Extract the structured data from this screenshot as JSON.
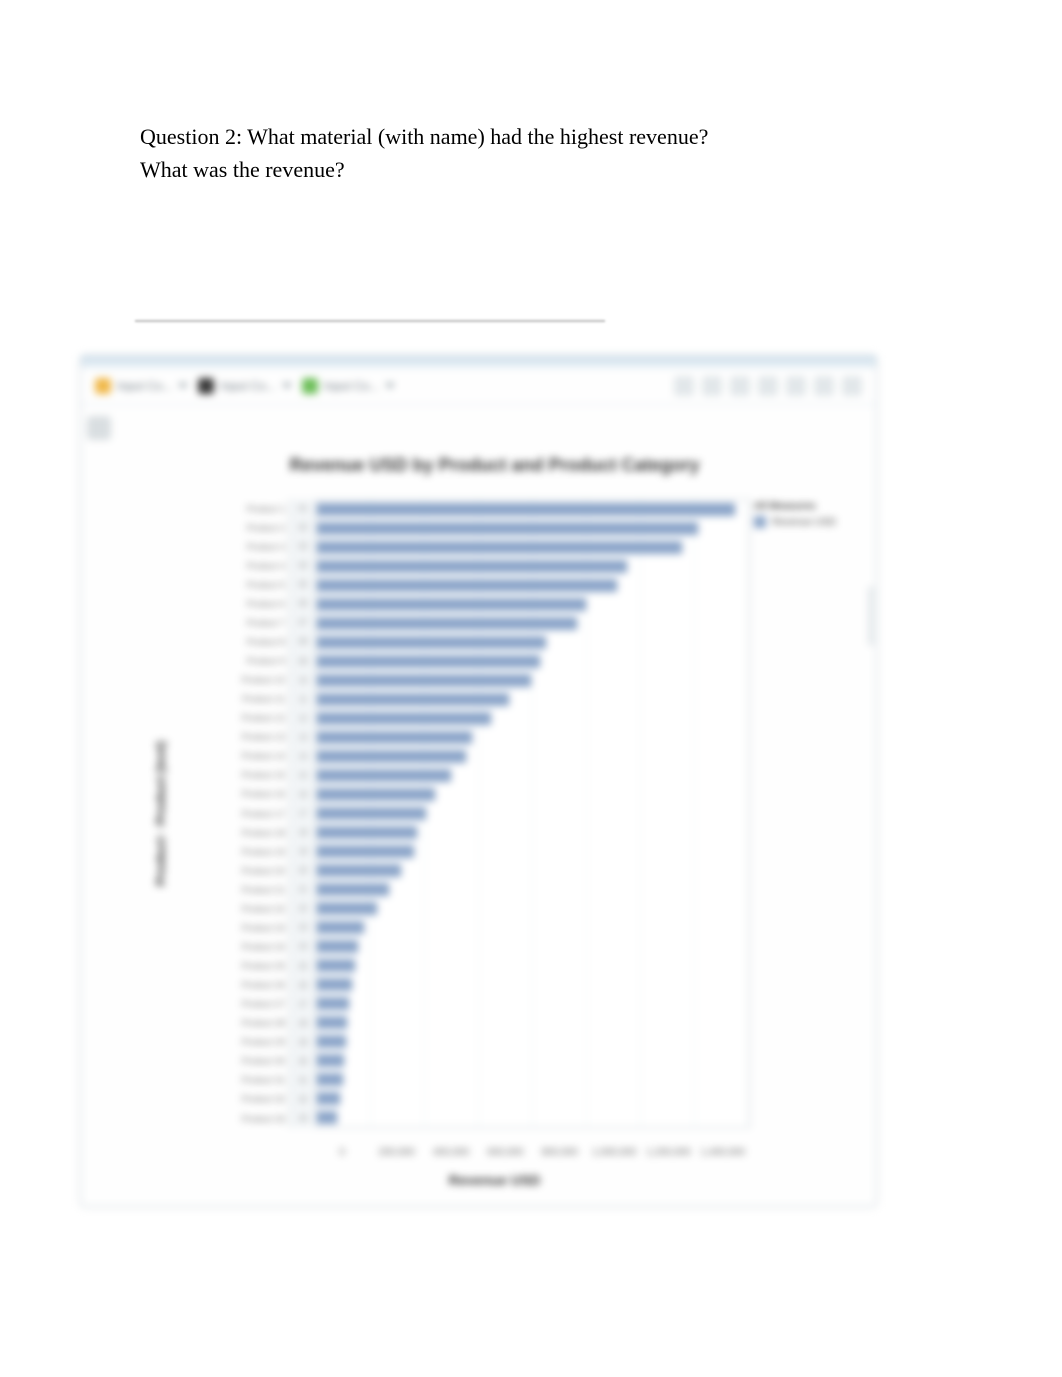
{
  "question_text": "Question 2: What material (with name) had the highest revenue? What was the revenue?",
  "toolbar": {
    "segments": [
      {
        "color": "#f0b84a",
        "label": "Input Co..."
      },
      {
        "color": "#3a3a3a",
        "label": "Input Co..."
      },
      {
        "color": "#6ebf5a",
        "label": "Input Co..."
      }
    ],
    "icons": [
      "search-icon",
      "filter-icon",
      "export-icon",
      "print-icon",
      "refresh-icon",
      "settings-icon",
      "close-icon"
    ]
  },
  "chart_data": {
    "type": "bar",
    "orientation": "horizontal",
    "title": "Revenue USD by Product and Product Category",
    "xlabel": "Revenue USD",
    "ylabel": "Product · Product (text)",
    "xlim": [
      0,
      1400000
    ],
    "xticks": [
      "0",
      "200,000",
      "400,000",
      "600,000",
      "800,000",
      "1,000,000",
      "1,200,000",
      "1,400,000"
    ],
    "legend_title": "All Measures",
    "legend_items": [
      "Revenue USD"
    ],
    "bar_color": "#8aa4c8",
    "categories": [
      "Product 1",
      "Product 2",
      "Product 3",
      "Product 4",
      "Product 5",
      "Product 6",
      "Product 7",
      "Product 8",
      "Product 9",
      "Product 10",
      "Product 11",
      "Product 12",
      "Product 13",
      "Product 14",
      "Product 15",
      "Product 16",
      "Product 17",
      "Product 18",
      "Product 19",
      "Product 20",
      "Product 21",
      "Product 22",
      "Product 23",
      "Product 24",
      "Product 25",
      "Product 26",
      "Product 27",
      "Product 28",
      "Product 29",
      "Product 30",
      "Product 31",
      "Product 32",
      "Product 33"
    ],
    "keys": [
      "01",
      "02",
      "03",
      "04",
      "05",
      "06",
      "07",
      "08",
      "09",
      "10",
      "11",
      "12",
      "13",
      "14",
      "15",
      "16",
      "17",
      "18",
      "19",
      "20",
      "21",
      "22",
      "23",
      "24",
      "25",
      "26",
      "27",
      "28",
      "29",
      "30",
      "31",
      "32",
      "33"
    ],
    "values": [
      1350000,
      1230000,
      1180000,
      1000000,
      970000,
      870000,
      840000,
      740000,
      720000,
      690000,
      620000,
      560000,
      500000,
      480000,
      430000,
      380000,
      350000,
      320000,
      310000,
      270000,
      230000,
      190000,
      150000,
      130000,
      120000,
      110000,
      100000,
      95000,
      90000,
      85000,
      80000,
      70000,
      60000
    ]
  }
}
